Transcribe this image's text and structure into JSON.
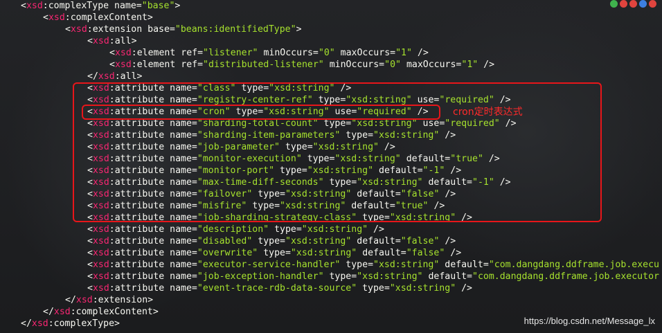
{
  "annotation_text": "cron定时表达式",
  "watermark": "https://blog.csdn.net/Message_lx",
  "colors": {
    "highlight": "#e8161a",
    "string": "#a6e22e",
    "namespace": "#f92672",
    "text": "#f8f8f2"
  },
  "window_dots": [
    {
      "name": "green-dot",
      "color": "#3fb24d"
    },
    {
      "name": "red-dot",
      "color": "#e0443e"
    },
    {
      "name": "red-dot-2",
      "color": "#e0443e"
    },
    {
      "name": "blue-dot",
      "color": "#3c7fe0"
    },
    {
      "name": "red-dot-3",
      "color": "#e0443e"
    }
  ],
  "lines": [
    {
      "indent": 1,
      "kind": "open",
      "ns": "xsd",
      "tag": "complexType",
      "attrs": [
        [
          "name",
          "base"
        ]
      ]
    },
    {
      "indent": 2,
      "kind": "open",
      "ns": "xsd",
      "tag": "complexContent",
      "attrs": []
    },
    {
      "indent": 3,
      "kind": "open",
      "ns": "xsd",
      "tag": "extension",
      "attrs": [
        [
          "base",
          "beans:identifiedType"
        ]
      ]
    },
    {
      "indent": 4,
      "kind": "open",
      "ns": "xsd",
      "tag": "all",
      "attrs": []
    },
    {
      "indent": 5,
      "kind": "self",
      "ns": "xsd",
      "tag": "element",
      "attrs": [
        [
          "ref",
          "listener"
        ],
        [
          "minOccurs",
          "0"
        ],
        [
          "maxOccurs",
          "1"
        ]
      ]
    },
    {
      "indent": 5,
      "kind": "self",
      "ns": "xsd",
      "tag": "element",
      "attrs": [
        [
          "ref",
          "distributed-listener"
        ],
        [
          "minOccurs",
          "0"
        ],
        [
          "maxOccurs",
          "1"
        ]
      ]
    },
    {
      "indent": 4,
      "kind": "close",
      "ns": "xsd",
      "tag": "all",
      "attrs": []
    },
    {
      "indent": 4,
      "kind": "self",
      "ns": "xsd",
      "tag": "attribute",
      "attrs": [
        [
          "name",
          "class"
        ],
        [
          "type",
          "xsd:string"
        ]
      ]
    },
    {
      "indent": 4,
      "kind": "self",
      "ns": "xsd",
      "tag": "attribute",
      "attrs": [
        [
          "name",
          "registry-center-ref"
        ],
        [
          "type",
          "xsd:string"
        ],
        [
          "use",
          "required"
        ]
      ]
    },
    {
      "indent": 4,
      "kind": "self",
      "ns": "xsd",
      "tag": "attribute",
      "attrs": [
        [
          "name",
          "cron"
        ],
        [
          "type",
          "xsd:string"
        ],
        [
          "use",
          "required"
        ]
      ]
    },
    {
      "indent": 4,
      "kind": "self",
      "ns": "xsd",
      "tag": "attribute",
      "attrs": [
        [
          "name",
          "sharding-total-count"
        ],
        [
          "type",
          "xsd:string"
        ],
        [
          "use",
          "required"
        ]
      ]
    },
    {
      "indent": 4,
      "kind": "self",
      "ns": "xsd",
      "tag": "attribute",
      "attrs": [
        [
          "name",
          "sharding-item-parameters"
        ],
        [
          "type",
          "xsd:string"
        ]
      ]
    },
    {
      "indent": 4,
      "kind": "self",
      "ns": "xsd",
      "tag": "attribute",
      "attrs": [
        [
          "name",
          "job-parameter"
        ],
        [
          "type",
          "xsd:string"
        ]
      ]
    },
    {
      "indent": 4,
      "kind": "self",
      "ns": "xsd",
      "tag": "attribute",
      "attrs": [
        [
          "name",
          "monitor-execution"
        ],
        [
          "type",
          "xsd:string"
        ],
        [
          "default",
          "true"
        ]
      ]
    },
    {
      "indent": 4,
      "kind": "self",
      "ns": "xsd",
      "tag": "attribute",
      "attrs": [
        [
          "name",
          "monitor-port"
        ],
        [
          "type",
          "xsd:string"
        ],
        [
          "default",
          "-1"
        ]
      ]
    },
    {
      "indent": 4,
      "kind": "self",
      "ns": "xsd",
      "tag": "attribute",
      "attrs": [
        [
          "name",
          "max-time-diff-seconds"
        ],
        [
          "type",
          "xsd:string"
        ],
        [
          "default",
          "-1"
        ]
      ]
    },
    {
      "indent": 4,
      "kind": "self",
      "ns": "xsd",
      "tag": "attribute",
      "attrs": [
        [
          "name",
          "failover"
        ],
        [
          "type",
          "xsd:string"
        ],
        [
          "default",
          "false"
        ]
      ]
    },
    {
      "indent": 4,
      "kind": "self",
      "ns": "xsd",
      "tag": "attribute",
      "attrs": [
        [
          "name",
          "misfire"
        ],
        [
          "type",
          "xsd:string"
        ],
        [
          "default",
          "true"
        ]
      ]
    },
    {
      "indent": 4,
      "kind": "self",
      "ns": "xsd",
      "tag": "attribute",
      "attrs": [
        [
          "name",
          "job-sharding-strategy-class"
        ],
        [
          "type",
          "xsd:string"
        ]
      ]
    },
    {
      "indent": 4,
      "kind": "self",
      "ns": "xsd",
      "tag": "attribute",
      "attrs": [
        [
          "name",
          "description"
        ],
        [
          "type",
          "xsd:string"
        ]
      ]
    },
    {
      "indent": 4,
      "kind": "self",
      "ns": "xsd",
      "tag": "attribute",
      "attrs": [
        [
          "name",
          "disabled"
        ],
        [
          "type",
          "xsd:string"
        ],
        [
          "default",
          "false"
        ]
      ]
    },
    {
      "indent": 4,
      "kind": "self",
      "ns": "xsd",
      "tag": "attribute",
      "attrs": [
        [
          "name",
          "overwrite"
        ],
        [
          "type",
          "xsd:string"
        ],
        [
          "default",
          "false"
        ]
      ]
    },
    {
      "indent": 4,
      "kind": "self_cut",
      "ns": "xsd",
      "tag": "attribute",
      "attrs": [
        [
          "name",
          "executor-service-handler"
        ],
        [
          "type",
          "xsd:string"
        ],
        [
          "default",
          "com.dangdang.ddframe.job.execu"
        ]
      ]
    },
    {
      "indent": 4,
      "kind": "self_cut",
      "ns": "xsd",
      "tag": "attribute",
      "attrs": [
        [
          "name",
          "job-exception-handler"
        ],
        [
          "type",
          "xsd:string"
        ],
        [
          "default",
          "com.dangdang.ddframe.job.executor"
        ]
      ]
    },
    {
      "indent": 4,
      "kind": "self",
      "ns": "xsd",
      "tag": "attribute",
      "attrs": [
        [
          "name",
          "event-trace-rdb-data-source"
        ],
        [
          "type",
          "xsd:string"
        ]
      ]
    },
    {
      "indent": 3,
      "kind": "close",
      "ns": "xsd",
      "tag": "extension",
      "attrs": []
    },
    {
      "indent": 2,
      "kind": "close",
      "ns": "xsd",
      "tag": "complexContent",
      "attrs": []
    },
    {
      "indent": 1,
      "kind": "close",
      "ns": "xsd",
      "tag": "complexType",
      "attrs": []
    }
  ]
}
